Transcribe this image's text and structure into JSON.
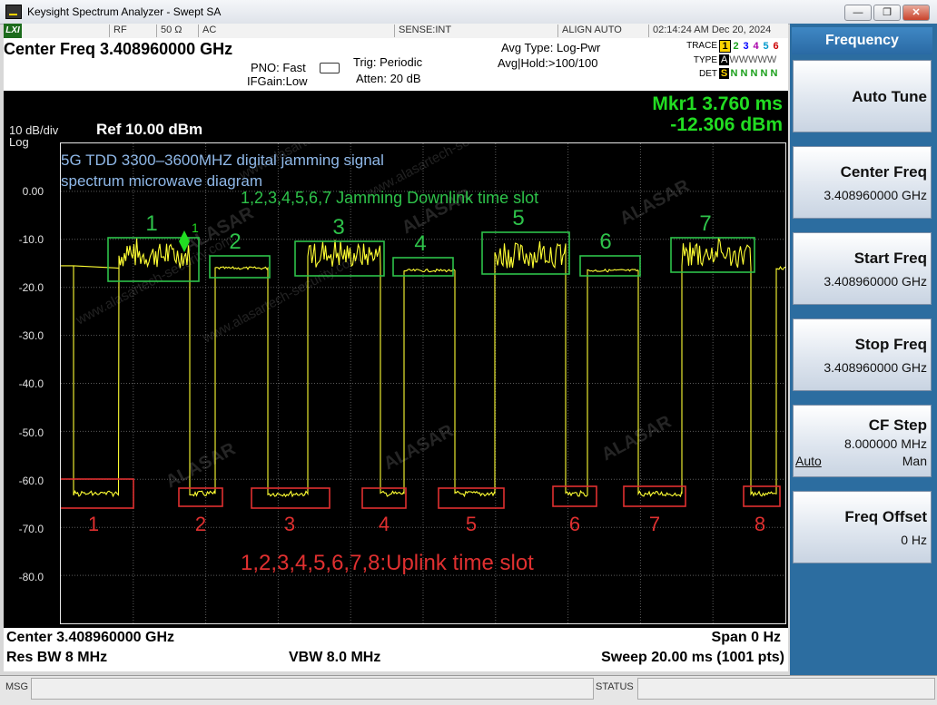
{
  "window": {
    "title": "Keysight Spectrum Analyzer - Swept SA"
  },
  "status_bar": {
    "lxi": "LXI",
    "rf": "RF",
    "impedance": "50 Ω",
    "coupling": "AC",
    "sense": "SENSE:INT",
    "align": "ALIGN AUTO",
    "datetime": "02:14:24 AM Dec 20, 2024"
  },
  "header": {
    "center_freq": "Center Freq 3.408960000 GHz",
    "pno": "PNO: Fast",
    "ifgain": "IFGain:Low",
    "trig": "Trig: Periodic",
    "atten": "Atten: 20 dB",
    "avg_type": "Avg Type: Log-Pwr",
    "avg_hold": "Avg|Hold:>100/100"
  },
  "trace_table": {
    "trace_label": "TRACE",
    "type_label": "TYPE",
    "det_label": "DET",
    "traces": [
      "1",
      "2",
      "3",
      "4",
      "5",
      "6"
    ],
    "type_value": "A",
    "type_rest": "WWWWW",
    "det_values": [
      "S",
      "N",
      "N",
      "N",
      "N",
      "N"
    ],
    "trace_colors": [
      "#000000",
      "#1aa01a",
      "#0000ff",
      "#aa00aa",
      "#0099cc",
      "#cc0000"
    ]
  },
  "marker": {
    "time": "Mkr1 3.760 ms",
    "level": "-12.306 dBm",
    "color": "#22dd22"
  },
  "scale": {
    "div": "10 dB/div",
    "log": "Log",
    "ref": "Ref 10.00 dBm"
  },
  "y_axis_labels": [
    "0.00",
    "-10.0",
    "-20.0",
    "-30.0",
    "-40.0",
    "-50.0",
    "-60.0",
    "-70.0",
    "-80.0"
  ],
  "annotations": {
    "title_line1": "5G TDD 3300–3600MHZ digital jamming signal",
    "title_line2": "spectrum microwave diagram",
    "downlink": "1,2,3,4,5,6,7 Jamming Downlink time slot",
    "uplink": "1,2,3,4,5,6,7,8:Uplink time slot",
    "downlink_numbers": [
      "1",
      "2",
      "3",
      "4",
      "5",
      "6",
      "7"
    ],
    "uplink_numbers": [
      "1",
      "2",
      "3",
      "4",
      "5",
      "6",
      "7",
      "8"
    ],
    "marker_number": "1",
    "downlink_color": "#2ec24a",
    "uplink_color": "#e03030",
    "title_color": "#8fb8e8",
    "trace_color": "#ffff33"
  },
  "watermark": {
    "brand": "ALASAR",
    "url": "www.alasartech-security.com"
  },
  "bottom": {
    "center": "Center 3.408960000 GHz",
    "span": "Span 0 Hz",
    "res_bw": "Res BW 8 MHz",
    "vbw": "VBW 8.0 MHz",
    "sweep": "Sweep  20.00 ms (1001 pts)"
  },
  "softkeys": {
    "menu_title": "Frequency",
    "auto_tune": "Auto Tune",
    "center_freq": {
      "label": "Center Freq",
      "value": "3.408960000 GHz"
    },
    "start_freq": {
      "label": "Start Freq",
      "value": "3.408960000 GHz"
    },
    "stop_freq": {
      "label": "Stop Freq",
      "value": "3.408960000 GHz"
    },
    "cf_step": {
      "label": "CF Step",
      "value": "8.000000 MHz",
      "auto": "Auto",
      "man": "Man"
    },
    "freq_offset": {
      "label": "Freq Offset",
      "value": "0 Hz"
    }
  },
  "message_bar": {
    "msg": "MSG",
    "status": "STATUS"
  }
}
